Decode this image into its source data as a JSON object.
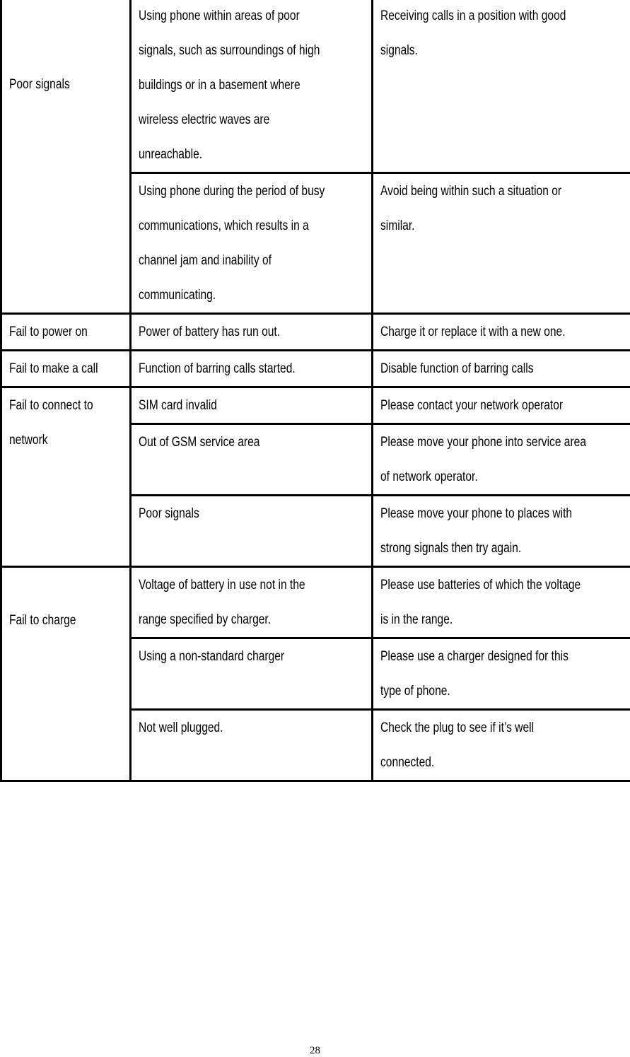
{
  "table": {
    "rows": [
      {
        "problem": [
          "Poor signals"
        ],
        "problem_rowspan": 2,
        "problem_pad": 97,
        "cause": [
          "Using phone within areas of poor",
          "signals, such as surroundings of high",
          "buildings or in a basement where",
          "wireless electric waves are",
          "unreachable."
        ],
        "solution": [
          "Receiving calls in a position with good",
          "signals."
        ],
        "height": 245
      },
      {
        "cause": [
          "Using phone during the period of busy",
          "communications, which results in a",
          "channel jam and inability of",
          "communicating."
        ],
        "solution": [
          "Avoid being within such a situation or",
          "similar."
        ],
        "height": 198
      },
      {
        "problem": [
          "Fail to power on"
        ],
        "problem_rowspan": 1,
        "cause": [
          "Power of battery has run out."
        ],
        "solution": [
          "Charge it or replace it with a new one."
        ],
        "height": 52
      },
      {
        "problem": [
          "Fail to make a call"
        ],
        "problem_rowspan": 1,
        "cause": [
          "Function of barring calls started."
        ],
        "solution": [
          "Disable function of barring calls"
        ],
        "height": 52
      },
      {
        "problem": [
          "Fail to connect to",
          "network"
        ],
        "problem_rowspan": 3,
        "cause": [
          "SIM card invalid"
        ],
        "solution": [
          "Please contact your network operator"
        ],
        "height": 52
      },
      {
        "cause": [
          "Out of GSM service area"
        ],
        "solution": [
          "Please move your phone into service area",
          "of network operator."
        ],
        "height": 100
      },
      {
        "cause": [
          "Poor signals"
        ],
        "solution": [
          "Please move your phone to    places with",
          "strong signals then try again."
        ],
        "height": 101
      },
      {
        "problem": [
          "Fail to charge"
        ],
        "problem_rowspan": 3,
        "problem_pad": 50,
        "cause": [
          "Voltage of battery in use not in the",
          "range specified by charger."
        ],
        "solution": [
          "Please use batteries of which the voltage",
          "is in the range."
        ],
        "height": 100
      },
      {
        "cause": [
          "Using a non-standard charger"
        ],
        "solution": [
          "Please use a charger designed for this",
          "type of phone."
        ],
        "height": 101
      },
      {
        "cause": [
          "Not well plugged."
        ],
        "solution": [
          "Check the plug to see if it’s well",
          "connected."
        ],
        "height": 101
      }
    ]
  },
  "page_number": "28"
}
